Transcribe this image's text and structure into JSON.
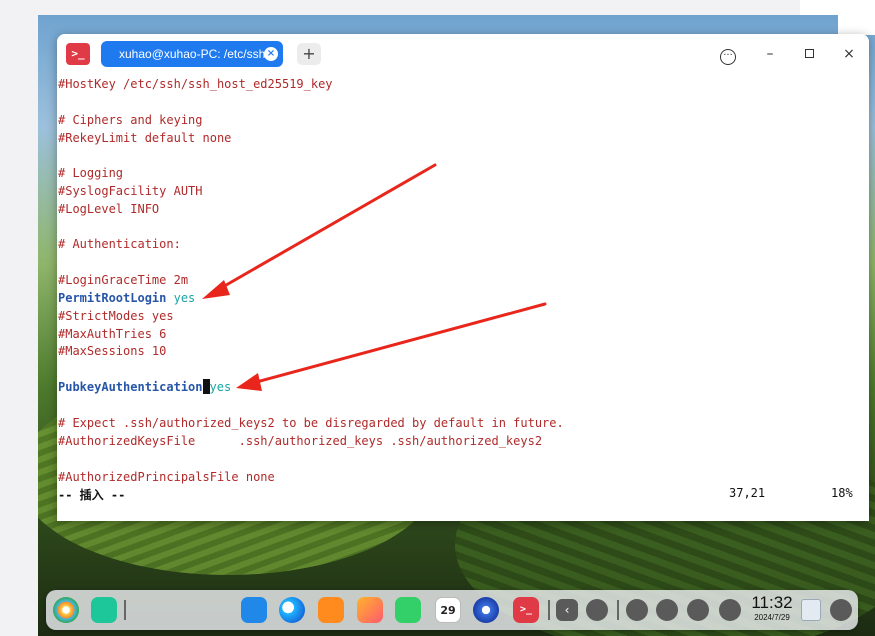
{
  "window": {
    "tab_title": "xuhao@xuhao-PC: /etc/ssh",
    "tab_close_icon": "×",
    "add_tab_icon": "+",
    "menu_icon": "···",
    "minimize_icon": "–",
    "close_icon": "×"
  },
  "terminal": {
    "lines": [
      {
        "text": "#HostKey /etc/ssh/ssh_host_ed25519_key",
        "kind": "comment"
      },
      {
        "text": "",
        "kind": "blank"
      },
      {
        "text": "# Ciphers and keying",
        "kind": "comment"
      },
      {
        "text": "#RekeyLimit default none",
        "kind": "comment"
      },
      {
        "text": "",
        "kind": "blank"
      },
      {
        "text": "# Logging",
        "kind": "comment"
      },
      {
        "text": "#SyslogFacility AUTH",
        "kind": "comment"
      },
      {
        "text": "#LogLevel INFO",
        "kind": "comment"
      },
      {
        "text": "",
        "kind": "blank"
      },
      {
        "text": "# Authentication:",
        "kind": "comment"
      },
      {
        "text": "",
        "kind": "blank"
      },
      {
        "text": "#LoginGraceTime 2m",
        "kind": "comment"
      },
      {
        "text": "PermitRootLogin",
        "value": "yes",
        "kind": "directive"
      },
      {
        "text": "#StrictModes yes",
        "kind": "comment"
      },
      {
        "text": "#MaxAuthTries 6",
        "kind": "comment"
      },
      {
        "text": "#MaxSessions 10",
        "kind": "comment"
      },
      {
        "text": "",
        "kind": "blank"
      },
      {
        "text": "PubkeyAuthentication",
        "value": "yes",
        "kind": "directive-cursor"
      },
      {
        "text": "",
        "kind": "blank"
      },
      {
        "text": "# Expect .ssh/authorized_keys2 to be disregarded by default in future.",
        "kind": "comment"
      },
      {
        "text": "#AuthorizedKeysFile      .ssh/authorized_keys .ssh/authorized_keys2",
        "kind": "comment"
      },
      {
        "text": "",
        "kind": "blank"
      },
      {
        "text": "#AuthorizedPrincipalsFile none",
        "kind": "comment"
      },
      {
        "text": "-- 插入 --",
        "kind": "status"
      }
    ],
    "cursor_position": "37,21",
    "scroll_percent": "18%"
  },
  "taskbar": {
    "icons": [
      "launcher-icon",
      "multitask-view-icon",
      "file-manager-icon",
      "browser-icon",
      "app-store-icon",
      "image-viewer-icon",
      "music-icon",
      "calendar-icon",
      "settings-icon",
      "terminal-icon",
      "collapse-arrow-icon",
      "keyboard-layout-icon",
      "system-monitor-icon",
      "search-icon",
      "onboard-keyboard-icon",
      "power-icon",
      "trash-icon",
      "notification-icon"
    ],
    "calendar_day": "29",
    "clock_time": "11:32",
    "clock_date": "2024/7/29"
  },
  "colors": {
    "comment": "#b02a2a",
    "keyword": "#2756a8",
    "value": "#1aa5a5",
    "tab_active": "#1f7af0",
    "annotation_arrow": "#e8261c"
  }
}
